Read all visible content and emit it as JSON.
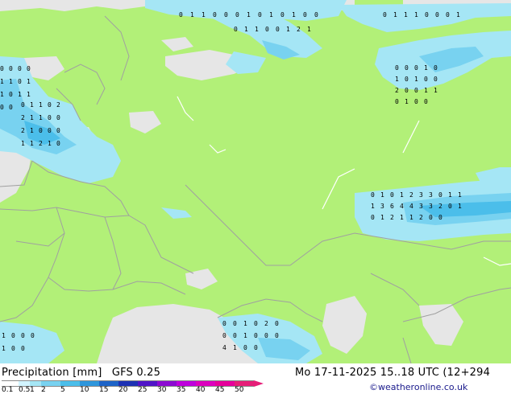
{
  "header": {
    "product": "Precipitation [mm]",
    "model": "GFS 0.25",
    "valid_time": "Mo 17-11-2025 15..18 UTC (12+294",
    "credit": "©weatheronline.co.uk"
  },
  "legend": {
    "labels": [
      "0.1",
      "0.5",
      "1",
      "2",
      "5",
      "10",
      "15",
      "20",
      "25",
      "30",
      "35",
      "40",
      "45",
      "50"
    ],
    "colors": [
      "#ffffff",
      "#d2f4ff",
      "#a5e6f5",
      "#78d2f0",
      "#4bbeea",
      "#2e96dc",
      "#1e64c8",
      "#1e32b4",
      "#5014c8",
      "#8c0ad2",
      "#be00dc",
      "#dc00be",
      "#e6009b",
      "#e61e78"
    ]
  },
  "map": {
    "land_color": "#b2f078",
    "sea_color": "#e6e6e6",
    "precip_light": "#a5e6f5",
    "precip_medium": "#78d2f0",
    "precip_heavy": "#4bbeea",
    "point_values": [
      {
        "region": "north-coast",
        "values": [
          "0",
          "1",
          "1",
          "0",
          "0",
          "0",
          "1",
          "0",
          "1",
          "0",
          "1",
          "0",
          "0"
        ]
      },
      {
        "region": "north-coast-2",
        "values": [
          "0",
          "1",
          "1",
          "0",
          "0",
          "1",
          "2",
          "1"
        ]
      },
      {
        "region": "north-east",
        "values": [
          "0",
          "1",
          "1",
          "1",
          "0",
          "0",
          "0",
          "1"
        ]
      },
      {
        "region": "baltic",
        "values": [
          "0",
          "1",
          "1",
          "0",
          "2",
          "2",
          "1",
          "1",
          "0",
          "0",
          "2",
          "1",
          "0",
          "0",
          "0",
          "1",
          "1",
          "2",
          "1",
          "0"
        ]
      },
      {
        "region": "scandinavia-west",
        "values": [
          "0",
          "0",
          "0",
          "0",
          "1",
          "1",
          "0",
          "1",
          "1",
          "0",
          "1",
          "1",
          "0",
          "0"
        ]
      },
      {
        "region": "west-siberia",
        "values": [
          "0",
          "0",
          "0",
          "1",
          "0",
          "1",
          "0",
          "1",
          "0",
          "0",
          "2",
          "0",
          "0",
          "1",
          "1",
          "0",
          "1",
          "0",
          "0"
        ]
      },
      {
        "region": "kazakh-band",
        "values": [
          "0",
          "1",
          "0",
          "1",
          "2",
          "3",
          "3",
          "0",
          "1",
          "1",
          "1",
          "3",
          "6",
          "4",
          "4",
          "3",
          "3",
          "2",
          "0",
          "1",
          "0",
          "1",
          "2",
          "1",
          "1",
          "2",
          "0",
          "0"
        ]
      },
      {
        "region": "black-sea",
        "values": [
          "0",
          "0",
          "1",
          "0",
          "2",
          "0",
          "0",
          "0",
          "1",
          "0",
          "0",
          "0",
          "4",
          "1",
          "0",
          "0"
        ]
      },
      {
        "region": "west-edge",
        "values": [
          "1",
          "0",
          "0",
          "0",
          "1",
          "0",
          "0"
        ]
      }
    ]
  }
}
